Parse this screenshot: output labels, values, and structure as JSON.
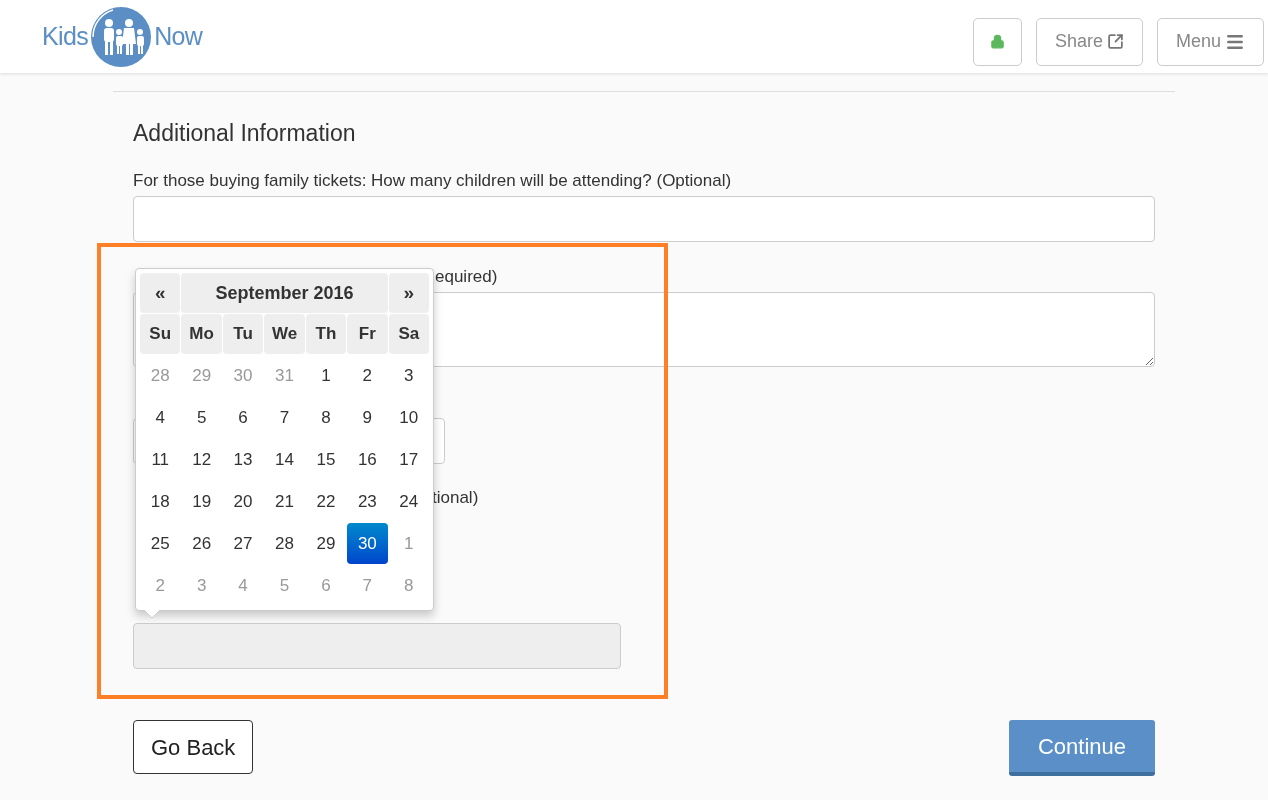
{
  "header": {
    "logo": {
      "left": "Kids",
      "right": "Now"
    },
    "buttons": [
      {
        "kind": "lock"
      },
      {
        "kind": "share",
        "label": "Share"
      },
      {
        "kind": "menu",
        "label": "Menu"
      }
    ]
  },
  "section_title": "Additional Information",
  "fields": [
    {
      "kind": "input",
      "label": "For those buying family tickets: How many children will be attending? (Optional)"
    },
    {
      "kind": "textarea",
      "label": "equired)"
    },
    {
      "kind": "select"
    },
    {
      "kind": "label",
      "label": "tional)"
    },
    {
      "kind": "readonly"
    }
  ],
  "calendar": {
    "prev": "«",
    "title": "September 2016",
    "next": "»",
    "weekdays": [
      "Su",
      "Mo",
      "Tu",
      "We",
      "Th",
      "Fr",
      "Sa"
    ],
    "weeks": [
      [
        {
          "day": "28",
          "muted": true,
          "selected": false
        },
        {
          "day": "29",
          "muted": true,
          "selected": false
        },
        {
          "day": "30",
          "muted": true,
          "selected": false
        },
        {
          "day": "31",
          "muted": true,
          "selected": false
        },
        {
          "day": "1",
          "muted": false,
          "selected": false
        },
        {
          "day": "2",
          "muted": false,
          "selected": false
        },
        {
          "day": "3",
          "muted": false,
          "selected": false
        }
      ],
      [
        {
          "day": "4",
          "muted": false,
          "selected": false
        },
        {
          "day": "5",
          "muted": false,
          "selected": false
        },
        {
          "day": "6",
          "muted": false,
          "selected": false
        },
        {
          "day": "7",
          "muted": false,
          "selected": false
        },
        {
          "day": "8",
          "muted": false,
          "selected": false
        },
        {
          "day": "9",
          "muted": false,
          "selected": false
        },
        {
          "day": "10",
          "muted": false,
          "selected": false
        }
      ],
      [
        {
          "day": "11",
          "muted": false,
          "selected": false
        },
        {
          "day": "12",
          "muted": false,
          "selected": false
        },
        {
          "day": "13",
          "muted": false,
          "selected": false
        },
        {
          "day": "14",
          "muted": false,
          "selected": false
        },
        {
          "day": "15",
          "muted": false,
          "selected": false
        },
        {
          "day": "16",
          "muted": false,
          "selected": false
        },
        {
          "day": "17",
          "muted": false,
          "selected": false
        }
      ],
      [
        {
          "day": "18",
          "muted": false,
          "selected": false
        },
        {
          "day": "19",
          "muted": false,
          "selected": false
        },
        {
          "day": "20",
          "muted": false,
          "selected": false
        },
        {
          "day": "21",
          "muted": false,
          "selected": false
        },
        {
          "day": "22",
          "muted": false,
          "selected": false
        },
        {
          "day": "23",
          "muted": false,
          "selected": false
        },
        {
          "day": "24",
          "muted": false,
          "selected": false
        }
      ],
      [
        {
          "day": "25",
          "muted": false,
          "selected": false
        },
        {
          "day": "26",
          "muted": false,
          "selected": false
        },
        {
          "day": "27",
          "muted": false,
          "selected": false
        },
        {
          "day": "28",
          "muted": false,
          "selected": false
        },
        {
          "day": "29",
          "muted": false,
          "selected": false
        },
        {
          "day": "30",
          "muted": false,
          "selected": true
        },
        {
          "day": "1",
          "muted": true,
          "selected": false
        }
      ],
      [
        {
          "day": "2",
          "muted": true,
          "selected": false
        },
        {
          "day": "3",
          "muted": true,
          "selected": false
        },
        {
          "day": "4",
          "muted": true,
          "selected": false
        },
        {
          "day": "5",
          "muted": true,
          "selected": false
        },
        {
          "day": "6",
          "muted": true,
          "selected": false
        },
        {
          "day": "7",
          "muted": true,
          "selected": false
        },
        {
          "day": "8",
          "muted": true,
          "selected": false
        }
      ]
    ]
  },
  "actions": [
    {
      "kind": "back",
      "label": "Go Back"
    },
    {
      "kind": "primary",
      "label": "Continue"
    }
  ]
}
